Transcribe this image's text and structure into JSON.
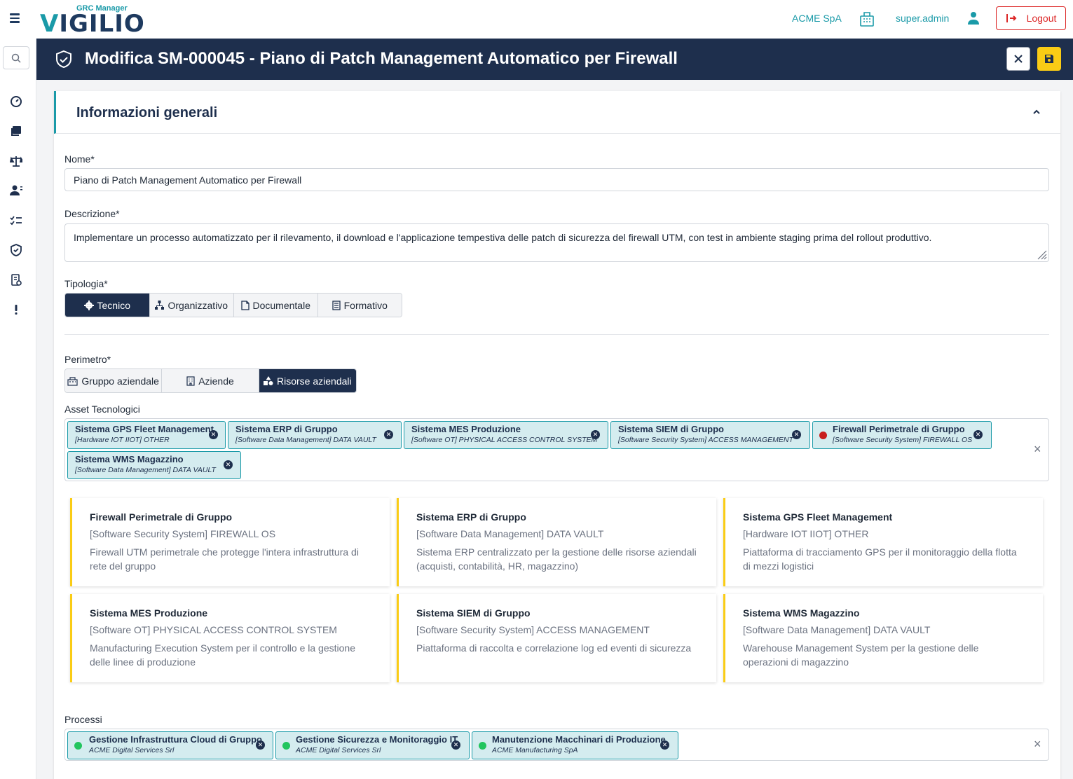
{
  "app": {
    "logo_sub": "GRC Manager",
    "logo_main": "IGILIO",
    "logo_v": "V",
    "company": "ACME SpA",
    "user": "super.admin",
    "logout_label": "Logout"
  },
  "header": {
    "title": "Modifica SM-000045 - Piano di Patch Management Automatico per Firewall"
  },
  "section": {
    "title": "Informazioni generali"
  },
  "form": {
    "nome_label": "Nome*",
    "nome_value": "Piano di Patch Management Automatico per Firewall",
    "descrizione_label": "Descrizione*",
    "descrizione_value": "Implementare un processo automatizzato per il rilevamento, il download e l'applicazione tempestiva delle patch di sicurezza del firewall UTM, con test in ambiente staging prima del rollout produttivo.",
    "tipologia_label": "Tipologia*",
    "tipologia": [
      {
        "label": "Tecnico",
        "icon": "gear-icon",
        "active": true
      },
      {
        "label": "Organizzativo",
        "icon": "sitemap-icon",
        "active": false
      },
      {
        "label": "Documentale",
        "icon": "file-icon",
        "active": false
      },
      {
        "label": "Formativo",
        "icon": "book-icon",
        "active": false
      }
    ],
    "perimetro_label": "Perimetro*",
    "perimetro": [
      {
        "label": "Gruppo aziendale",
        "icon": "building-group-icon",
        "active": false
      },
      {
        "label": "Aziende",
        "icon": "building-icon",
        "active": false
      },
      {
        "label": "Risorse aziendali",
        "icon": "shapes-icon",
        "active": true
      }
    ],
    "asset_label": "Asset Tecnologici",
    "asset_chips": [
      {
        "title": "Sistema GPS Fleet Management",
        "sub": "[Hardware IOT IIOT] OTHER"
      },
      {
        "title": "Sistema ERP di Gruppo",
        "sub": "[Software Data Management] DATA VAULT"
      },
      {
        "title": "Sistema MES Produzione",
        "sub": "[Software OT] PHYSICAL ACCESS CONTROL SYSTEM"
      },
      {
        "title": "Sistema SIEM di Gruppo",
        "sub": "[Software Security System] ACCESS MANAGEMENT"
      },
      {
        "title": "Firewall Perimetrale di Gruppo",
        "sub": "[Software Security System] FIREWALL OS",
        "status_color": "#c81e1e"
      },
      {
        "title": "Sistema WMS Magazzino",
        "sub": "[Software Data Management] DATA VAULT"
      }
    ],
    "asset_cards": [
      {
        "name": "Firewall Perimetrale di Gruppo",
        "category": "[Software Security System] FIREWALL OS",
        "desc": "Firewall UTM perimetrale che protegge l'intera infrastruttura di rete del gruppo"
      },
      {
        "name": "Sistema ERP di Gruppo",
        "category": "[Software Data Management] DATA VAULT",
        "desc": "Sistema ERP centralizzato per la gestione delle risorse aziendali (acquisti, contabilità, HR, magazzino)"
      },
      {
        "name": "Sistema GPS Fleet Management",
        "category": "[Hardware IOT IIOT] OTHER",
        "desc": "Piattaforma di tracciamento GPS per il monitoraggio della flotta di mezzi logistici"
      },
      {
        "name": "Sistema MES Produzione",
        "category": "[Software OT] PHYSICAL ACCESS CONTROL SYSTEM",
        "desc": "Manufacturing Execution System per il controllo e la gestione delle linee di produzione"
      },
      {
        "name": "Sistema SIEM di Gruppo",
        "category": "[Software Security System] ACCESS MANAGEMENT",
        "desc": "Piattaforma di raccolta e correlazione log ed eventi di sicurezza"
      },
      {
        "name": "Sistema WMS Magazzino",
        "category": "[Software Data Management] DATA VAULT",
        "desc": "Warehouse Management System per la gestione delle operazioni di magazzino"
      }
    ],
    "processi_label": "Processi",
    "processi_chips": [
      {
        "title": "Gestione Infrastruttura Cloud di Gruppo",
        "sub": "ACME Digital Services Srl",
        "status_color": "#22c55e"
      },
      {
        "title": "Gestione Sicurezza e Monitoraggio IT",
        "sub": "ACME Digital Services Srl",
        "status_color": "#22c55e"
      },
      {
        "title": "Manutenzione Macchinari di Produzione",
        "sub": "ACME Manufacturing SpA",
        "status_color": "#22c55e"
      }
    ]
  },
  "colors": {
    "navy": "#1e2f4d",
    "teal": "#1a9aa8",
    "accent_yellow": "#facc15",
    "danger": "#dc2626"
  }
}
